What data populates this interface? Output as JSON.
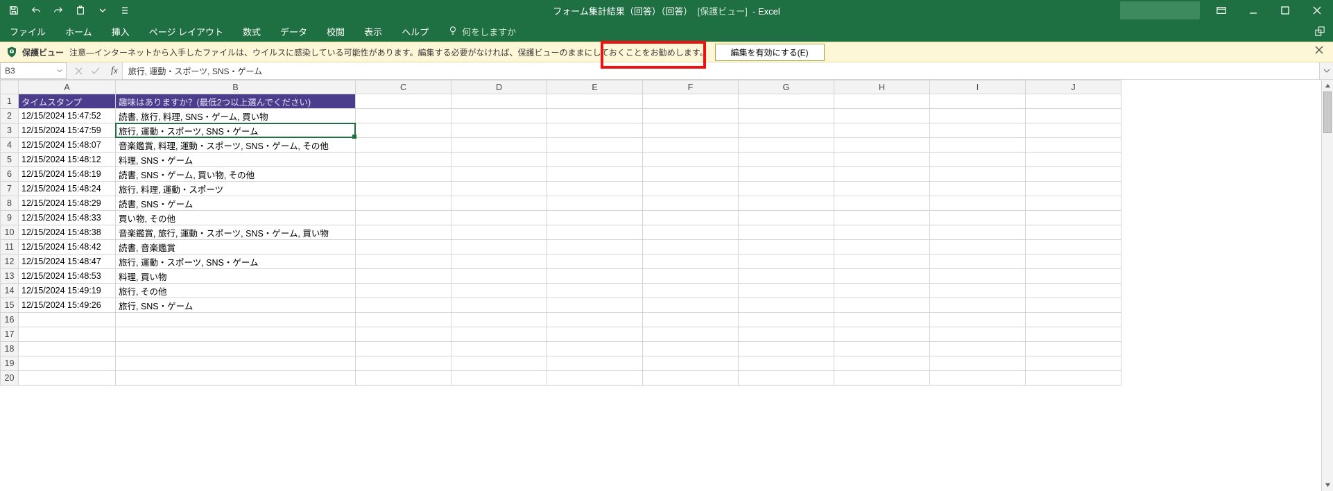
{
  "title": {
    "doc": "フォーム集計結果（回答）（回答）",
    "mode": "[保護ビュー]",
    "app": "Excel"
  },
  "ribbon": {
    "tabs": [
      "ファイル",
      "ホーム",
      "挿入",
      "ページ レイアウト",
      "数式",
      "データ",
      "校閲",
      "表示",
      "ヘルプ"
    ],
    "tellme": "何をしますか"
  },
  "protected_view": {
    "label": "保護ビュー",
    "message": "注意—インターネットから入手したファイルは、ウイルスに感染している可能性があります。編集する必要がなければ、保護ビューのままにしておくことをお勧めします。",
    "enable_button": "編集を有効にする(E)"
  },
  "name_box": "B3",
  "formula": "旅行, 運動・スポーツ, SNS・ゲーム",
  "columns": [
    "A",
    "B",
    "C",
    "D",
    "E",
    "F",
    "G",
    "H",
    "I",
    "J"
  ],
  "header_row": {
    "A": "タイムスタンプ",
    "B": "趣味はありますか？(最低2つ以上選んでください)"
  },
  "rows": [
    {
      "ts": "12/15/2024 15:47:52",
      "val": "読書, 旅行, 料理, SNS・ゲーム, 買い物"
    },
    {
      "ts": "12/15/2024 15:47:59",
      "val": "旅行, 運動・スポーツ, SNS・ゲーム"
    },
    {
      "ts": "12/15/2024 15:48:07",
      "val": "音楽鑑賞, 料理, 運動・スポーツ, SNS・ゲーム, その他"
    },
    {
      "ts": "12/15/2024 15:48:12",
      "val": "料理, SNS・ゲーム"
    },
    {
      "ts": "12/15/2024 15:48:19",
      "val": "読書, SNS・ゲーム, 買い物, その他"
    },
    {
      "ts": "12/15/2024 15:48:24",
      "val": "旅行, 料理, 運動・スポーツ"
    },
    {
      "ts": "12/15/2024 15:48:29",
      "val": "読書, SNS・ゲーム"
    },
    {
      "ts": "12/15/2024 15:48:33",
      "val": "買い物, その他"
    },
    {
      "ts": "12/15/2024 15:48:38",
      "val": "音楽鑑賞, 旅行, 運動・スポーツ, SNS・ゲーム, 買い物"
    },
    {
      "ts": "12/15/2024 15:48:42",
      "val": "読書, 音楽鑑賞"
    },
    {
      "ts": "12/15/2024 15:48:47",
      "val": "旅行, 運動・スポーツ, SNS・ゲーム"
    },
    {
      "ts": "12/15/2024 15:48:53",
      "val": "料理, 買い物"
    },
    {
      "ts": "12/15/2024 15:49:19",
      "val": "旅行, その他"
    },
    {
      "ts": "12/15/2024 15:49:26",
      "val": "旅行, SNS・ゲーム"
    }
  ],
  "extra_empty_rows": 5,
  "active_cell": "B3"
}
